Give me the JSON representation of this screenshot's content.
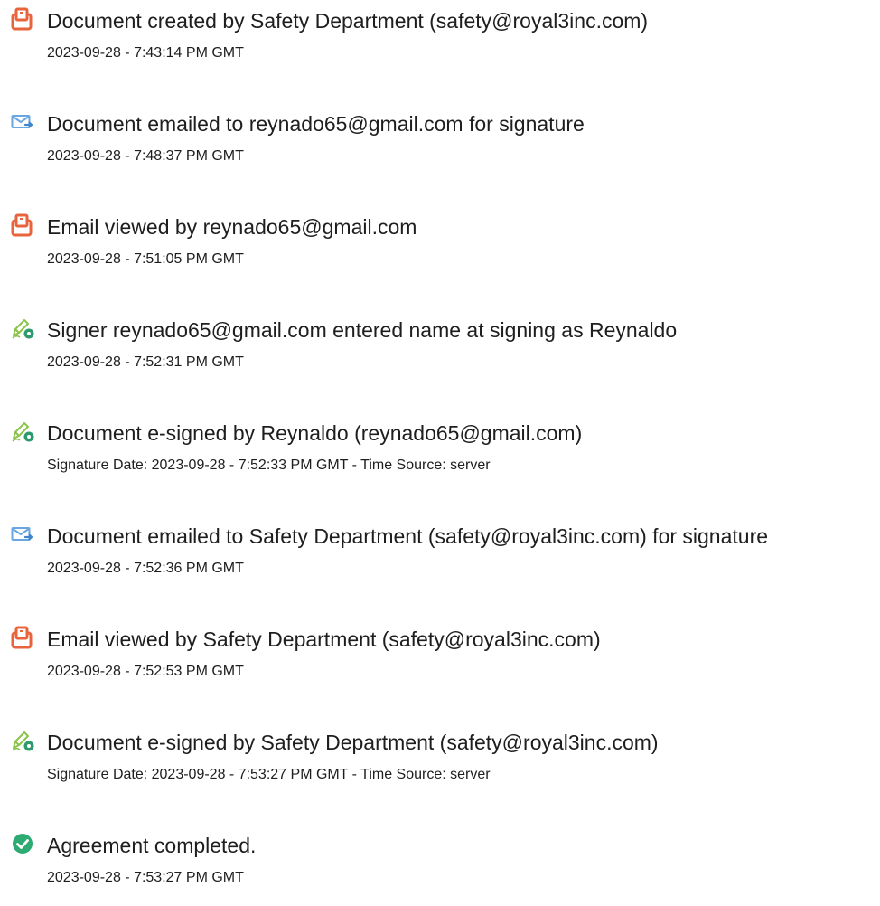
{
  "events": [
    {
      "icon": "document-created-icon",
      "title": "Document created by Safety Department (safety@royal3inc.com)",
      "date": "2023-09-28 - 7:43:14 PM GMT"
    },
    {
      "icon": "email-sent-icon",
      "title": "Document emailed to reynado65@gmail.com for signature",
      "date": "2023-09-28 - 7:48:37 PM GMT"
    },
    {
      "icon": "document-viewed-icon",
      "title": "Email viewed by reynado65@gmail.com",
      "date": "2023-09-28 - 7:51:05 PM GMT"
    },
    {
      "icon": "pen-sign-icon",
      "title": "Signer reynado65@gmail.com entered name at signing as Reynaldo",
      "date": "2023-09-28 - 7:52:31 PM GMT"
    },
    {
      "icon": "pen-sign-icon",
      "title": "Document e-signed by Reynaldo (reynado65@gmail.com)",
      "date": "Signature Date: 2023-09-28 - 7:52:33 PM GMT - Time Source: server"
    },
    {
      "icon": "email-sent-icon",
      "title": "Document emailed to Safety Department (safety@royal3inc.com) for signature",
      "date": "2023-09-28 - 7:52:36 PM GMT"
    },
    {
      "icon": "document-viewed-icon",
      "title": "Email viewed by Safety Department (safety@royal3inc.com)",
      "date": "2023-09-28 - 7:52:53 PM GMT"
    },
    {
      "icon": "pen-sign-icon",
      "title": "Document e-signed by Safety Department (safety@royal3inc.com)",
      "date": "Signature Date: 2023-09-28 - 7:53:27 PM GMT - Time Source: server"
    },
    {
      "icon": "check-circle-icon",
      "title": "Agreement completed.",
      "date": "2023-09-28 - 7:53:27 PM GMT"
    }
  ],
  "colors": {
    "document_icon": "#e8643c",
    "email_icon": "#5b9bd5",
    "pen_icon": "#8bc34a",
    "pen_badge": "#2e9b6e",
    "check_icon": "#2eaa73"
  }
}
